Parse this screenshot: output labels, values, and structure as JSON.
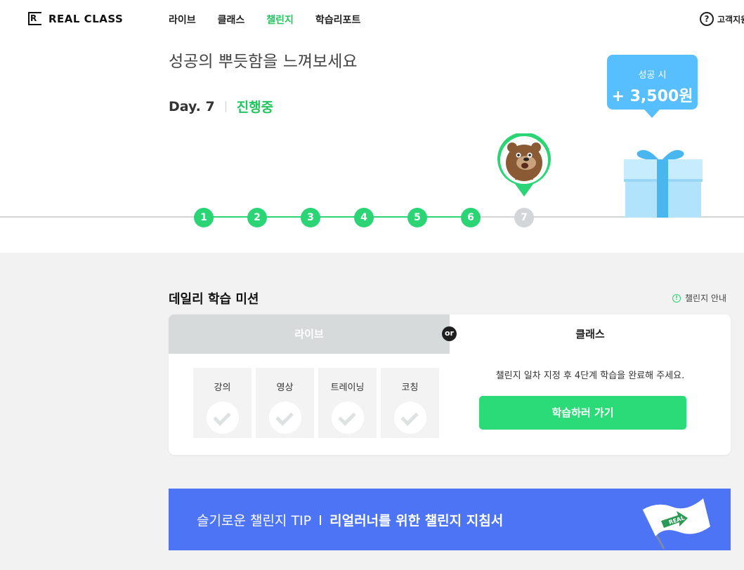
{
  "brand": {
    "logo_mark": "R",
    "name": "REAL CLASS"
  },
  "nav": {
    "items": [
      {
        "label": "라이브",
        "active": false
      },
      {
        "label": "클래스",
        "active": false
      },
      {
        "label": "챌린지",
        "active": true
      },
      {
        "label": "학습리포트",
        "active": false
      }
    ]
  },
  "help": {
    "icon": "question-icon",
    "label": "고객지원"
  },
  "hero": {
    "title": "성공의 뿌듯함을 느껴보세요",
    "day_label": "Day. 7",
    "status": "진행중"
  },
  "progress": {
    "steps": [
      {
        "label": "1",
        "done": true
      },
      {
        "label": "2",
        "done": true
      },
      {
        "label": "3",
        "done": true
      },
      {
        "label": "4",
        "done": true
      },
      {
        "label": "5",
        "done": true
      },
      {
        "label": "6",
        "done": true
      },
      {
        "label": "7",
        "done": false
      }
    ],
    "current_day": 7
  },
  "reward": {
    "label": "성공 시",
    "amount": "+ 3,500원",
    "icon": "gift-icon"
  },
  "mission": {
    "title": "데일리 학습 미션",
    "guide_label": "챌린지 안내",
    "tabs": {
      "live": "라이브",
      "or": "or",
      "class": "클래스"
    },
    "live_items": [
      {
        "label": "강의"
      },
      {
        "label": "영상"
      },
      {
        "label": "트레이닝"
      },
      {
        "label": "코칭"
      }
    ],
    "class_desc": "챌린지 일차 지정 후 4단계 학습을 완료해 주세요.",
    "cta": "학습하러 가기"
  },
  "tip": {
    "prefix": "슬기로운 챌린지 TIP",
    "strong": "리얼러너를 위한 챌린지 지침서",
    "flag_text": "REAL"
  },
  "colors": {
    "accent_green": "#2bd575",
    "tip_blue": "#4d74f5",
    "reward_blue": "#57bffe"
  }
}
